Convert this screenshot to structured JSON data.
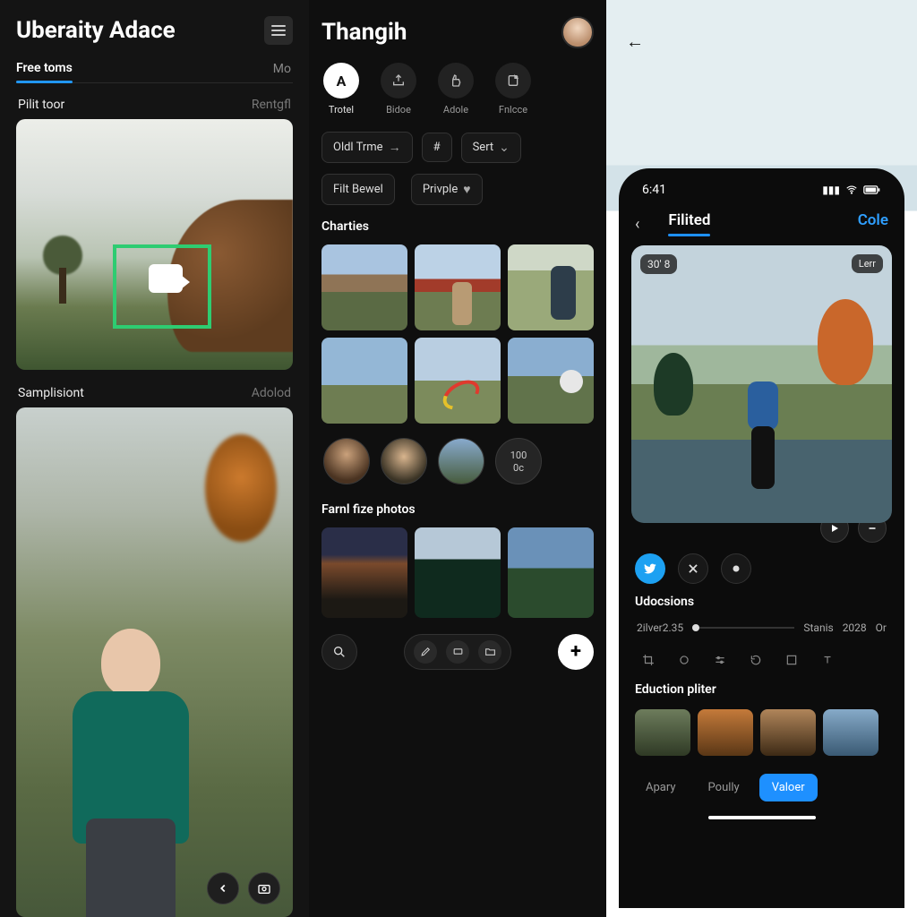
{
  "panel1": {
    "header_title": "Uberaity Adace",
    "tab_active": "Free toms",
    "tab_secondary": "Mo",
    "section1": {
      "label": "Pilit toor",
      "right": "Rentgfl"
    },
    "section2": {
      "label": "Samplisiont",
      "right": "Adolod"
    },
    "fab1_icon": "chevron-left",
    "fab2_icon": "camera"
  },
  "panel2": {
    "title": "Thangih",
    "nav": [
      {
        "label": "Trotel",
        "icon": "A"
      },
      {
        "label": "Bidoe",
        "icon": "export"
      },
      {
        "label": "Adole",
        "icon": "thumb"
      },
      {
        "label": "Fnlcce",
        "icon": "note"
      }
    ],
    "pill_time": "Oldl Trme",
    "pill_hash": "#",
    "pill_sort": "Sert",
    "pill_filtbewel": "Filt Bewel",
    "pill_priuple": "Privple",
    "section_charties": "Charties",
    "story_badge": {
      "top": "100",
      "bot": "0c"
    },
    "section_farni": "Farnl fize photos",
    "bottom_icons": {
      "search": "search",
      "edit": "edit",
      "folder": "folder",
      "plus": "plus"
    }
  },
  "panel3": {
    "status_time": "6:41",
    "tab_active": "Filited",
    "tab_right": "Cole",
    "hero_badge_left": "30' 8",
    "hero_badge_right": "Lerr",
    "section_udocsions": "Udocsions",
    "timeline": {
      "left": "2ilver",
      "mid": "2.35",
      "right1": "Stanis",
      "right2": "2028",
      "far": "Or"
    },
    "section_filter": "Eduction pliter",
    "bottom_tabs": {
      "a": "Apary",
      "b": "Poully",
      "c": "Valoer"
    }
  }
}
